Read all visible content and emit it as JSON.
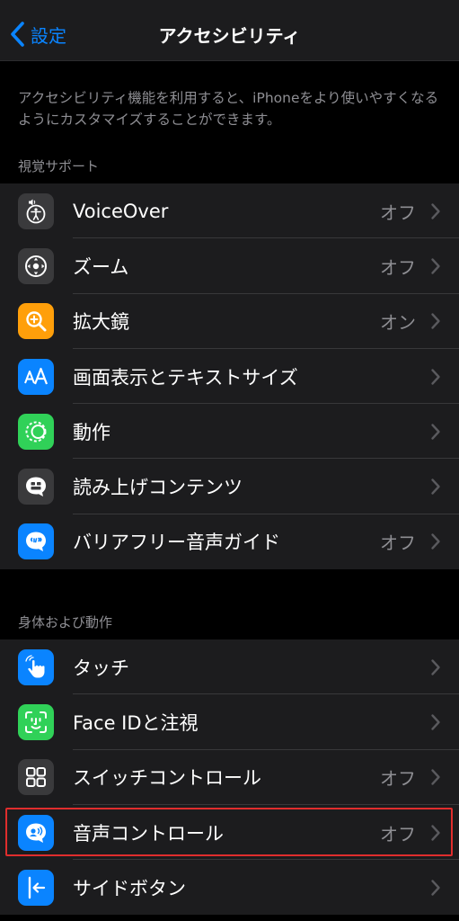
{
  "nav": {
    "back_label": "設定",
    "title": "アクセシビリティ"
  },
  "intro": "アクセシビリティ機能を利用すると、iPhoneをより使いやすくなるようにカスタマイズすることができます。",
  "sections": [
    {
      "header": "視覚サポート",
      "items": [
        {
          "label": "VoiceOver",
          "value": "オフ",
          "icon": "voiceover-icon",
          "color": "#3a3a3c"
        },
        {
          "label": "ズーム",
          "value": "オフ",
          "icon": "zoom-icon",
          "color": "#3a3a3c"
        },
        {
          "label": "拡大鏡",
          "value": "オン",
          "icon": "magnifier-icon",
          "color": "#ff9f0a"
        },
        {
          "label": "画面表示とテキストサイズ",
          "value": "",
          "icon": "text-size-icon",
          "color": "#0a84ff"
        },
        {
          "label": "動作",
          "value": "",
          "icon": "motion-icon",
          "color": "#30d158"
        },
        {
          "label": "読み上げコンテンツ",
          "value": "",
          "icon": "spoken-content-icon",
          "color": "#3a3a3c"
        },
        {
          "label": "バリアフリー音声ガイド",
          "value": "オフ",
          "icon": "audio-description-icon",
          "color": "#0a84ff"
        }
      ]
    },
    {
      "header": "身体および動作",
      "items": [
        {
          "label": "タッチ",
          "value": "",
          "icon": "touch-icon",
          "color": "#0a84ff"
        },
        {
          "label": "Face IDと注視",
          "value": "",
          "icon": "face-id-icon",
          "color": "#30d158"
        },
        {
          "label": "スイッチコントロール",
          "value": "オフ",
          "icon": "switch-control-icon",
          "color": "#3a3a3c"
        },
        {
          "label": "音声コントロール",
          "value": "オフ",
          "icon": "voice-control-icon",
          "color": "#0a84ff"
        },
        {
          "label": "サイドボタン",
          "value": "",
          "icon": "side-button-icon",
          "color": "#0a84ff"
        }
      ]
    }
  ],
  "highlight_color": "#e02d2d"
}
